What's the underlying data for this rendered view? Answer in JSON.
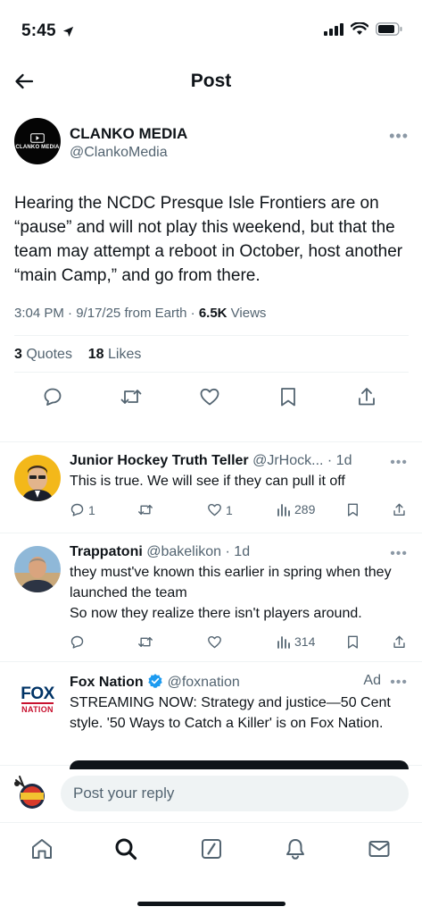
{
  "status_bar": {
    "time": "5:45"
  },
  "header": {
    "title": "Post"
  },
  "post": {
    "author_name": "CLANKO MEDIA",
    "author_handle": "@ClankoMedia",
    "avatar_text": "CLANKO MEDIA",
    "text": "Hearing the NCDC Presque Isle Frontiers are on “pause” and will not play this weekend, but that the team may attempt a reboot in October, host another “main Camp,” and go from there.",
    "time": "3:04 PM",
    "date": "9/17/25",
    "source": "from Earth",
    "views_count": "6.5K",
    "views_label": "Views",
    "quotes_count": "3",
    "quotes_label": "Quotes",
    "likes_count": "18",
    "likes_label": "Likes"
  },
  "replies": [
    {
      "name": "Junior Hockey Truth Teller",
      "handle": "@JrHock...",
      "time": "· 1d",
      "text": "This is true. We will see if they can pull it off",
      "replies": "1",
      "reposts": "",
      "likes": "1",
      "views": "289"
    },
    {
      "name": "Trappatoni",
      "handle": "@bakelikon",
      "time": "· 1d",
      "text": "they must've known this earlier in spring when they launched the team\nSo now they realize there isn't players around.",
      "replies": "",
      "reposts": "",
      "likes": "",
      "views": "314"
    }
  ],
  "ad": {
    "name": "Fox Nation",
    "handle": "@foxnation",
    "label": "Ad",
    "logo_line1": "FOX",
    "logo_line2": "NATION",
    "text": "STREAMING NOW: Strategy and justice—50 Cent style. '50 Ways to Catch a Killer' is on Fox Nation."
  },
  "reply_bar": {
    "placeholder": "Post your reply"
  },
  "colors": {
    "text": "#0f1419",
    "secondary": "#536471",
    "divider": "#eff3f4",
    "verified": "#1d9bf0",
    "fox_blue": "#003366",
    "fox_red": "#c8102e"
  },
  "tabs": [
    "home-icon",
    "search-icon",
    "grok-icon",
    "notifications-icon",
    "messages-icon"
  ]
}
